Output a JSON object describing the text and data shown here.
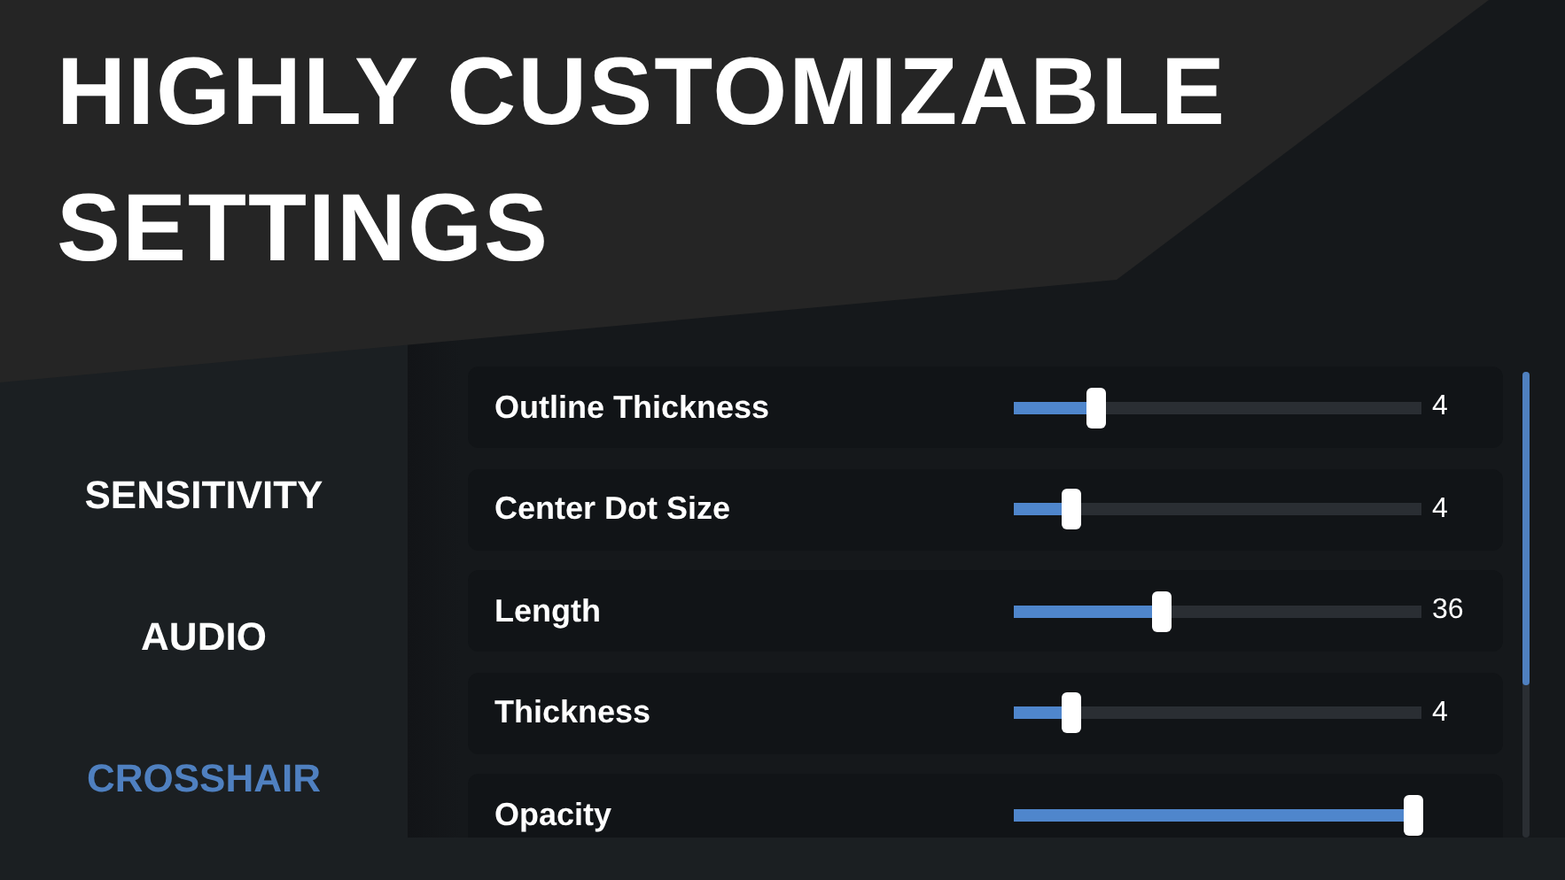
{
  "banner": {
    "title_lines": [
      "HIGHLY CUSTOMIZABLE",
      "SETTINGS"
    ]
  },
  "sidebar": {
    "items": [
      {
        "label": "SENSITIVITY",
        "selected": false
      },
      {
        "label": "AUDIO",
        "selected": false
      },
      {
        "label": "CROSSHAIR",
        "selected": true
      }
    ]
  },
  "settings": [
    {
      "label": "Outline Thickness",
      "level": 0.2,
      "reading": "4"
    },
    {
      "label": "Center Dot Size",
      "level": 0.14,
      "reading": "4"
    },
    {
      "label": "Length",
      "level": 0.36,
      "reading": "36"
    },
    {
      "label": "Thickness",
      "level": 0.14,
      "reading": "4"
    },
    {
      "label": "Opacity",
      "level": 0.98
    }
  ]
}
